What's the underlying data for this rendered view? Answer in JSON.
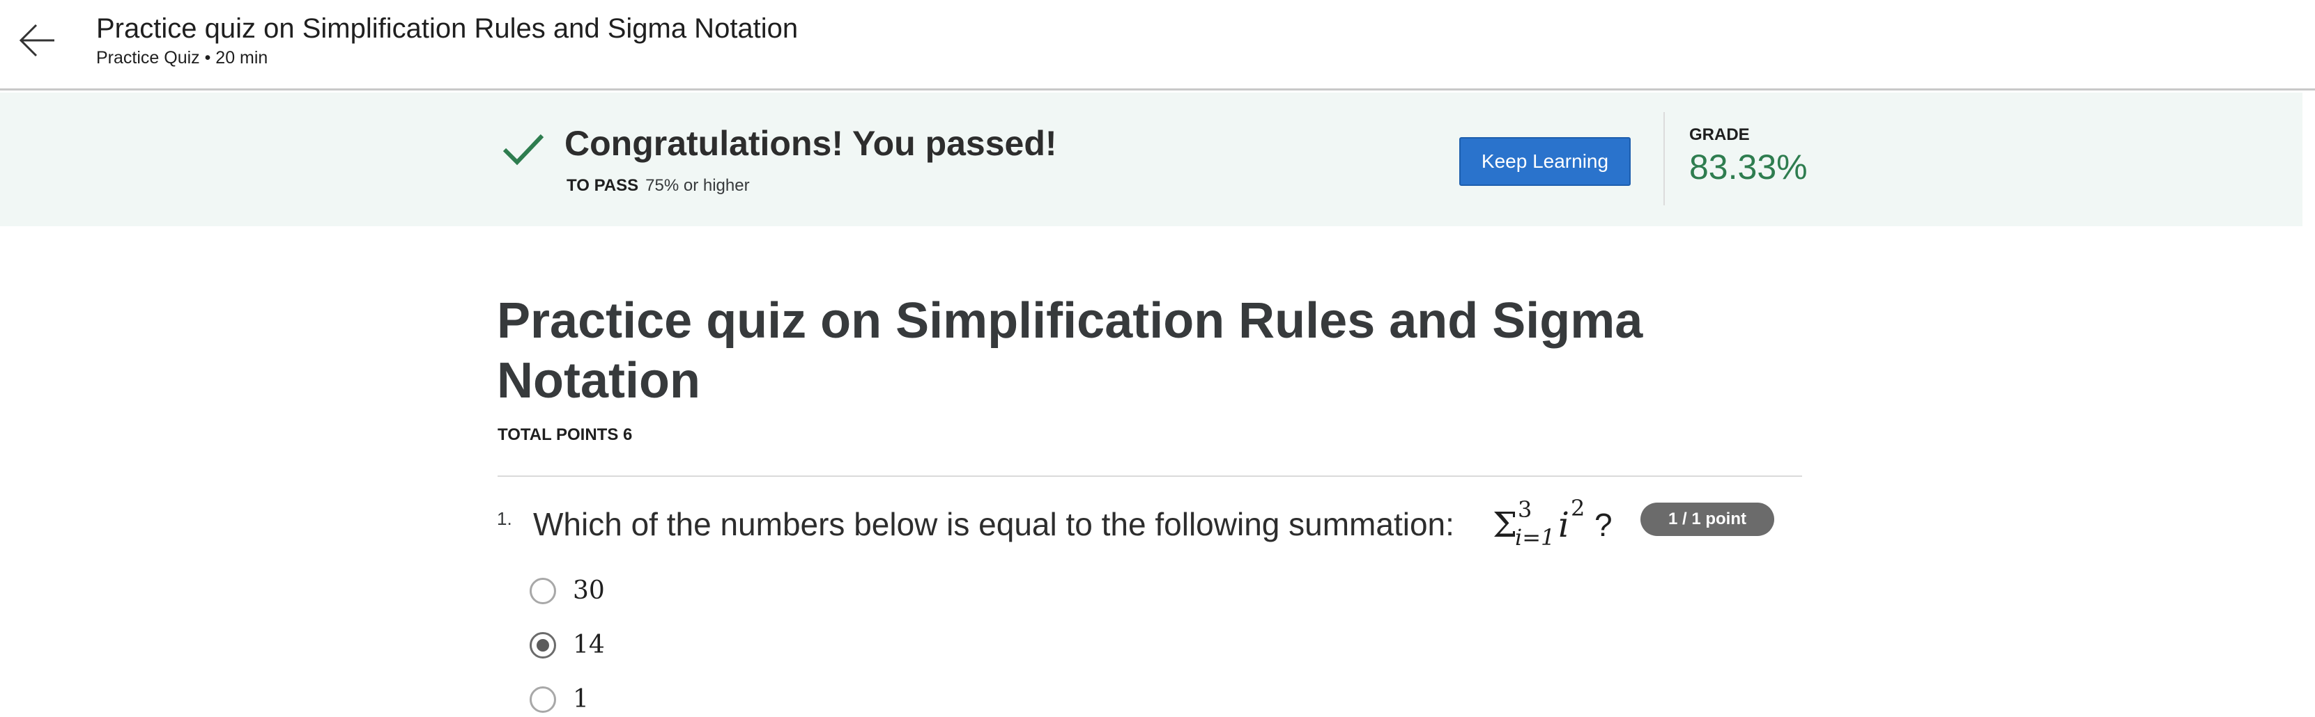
{
  "header": {
    "title": "Practice quiz on Simplification Rules and Sigma Notation",
    "subtitle": "Practice Quiz • 20 min",
    "back_icon": "arrow-left-icon"
  },
  "banner": {
    "icon": "checkmark-icon",
    "message": "Congratulations! You passed!",
    "to_pass_label": "TO PASS",
    "to_pass_value": "75% or higher",
    "button_label": "Keep Learning",
    "grade_label": "GRADE",
    "grade_value": "83.33%",
    "colors": {
      "banner_bg": "#f1f7f5",
      "check": "#2e7d4f",
      "grade": "#2e7d4f",
      "button": "#2a73cc"
    }
  },
  "quiz": {
    "title": "Practice quiz on Simplification Rules and Sigma Notation",
    "total_points": "TOTAL POINTS 6",
    "questions": [
      {
        "number": "1.",
        "text": "Which of the numbers below is equal to the following summation:",
        "math": {
          "sigma": "Σ",
          "upper": "3",
          "lower": "i=1",
          "term": "i",
          "exponent": "2",
          "suffix": "?"
        },
        "points_badge": "1 / 1 point",
        "options": [
          {
            "label": "30",
            "selected": false
          },
          {
            "label": "14",
            "selected": true
          },
          {
            "label": "1",
            "selected": false
          }
        ]
      }
    ]
  }
}
